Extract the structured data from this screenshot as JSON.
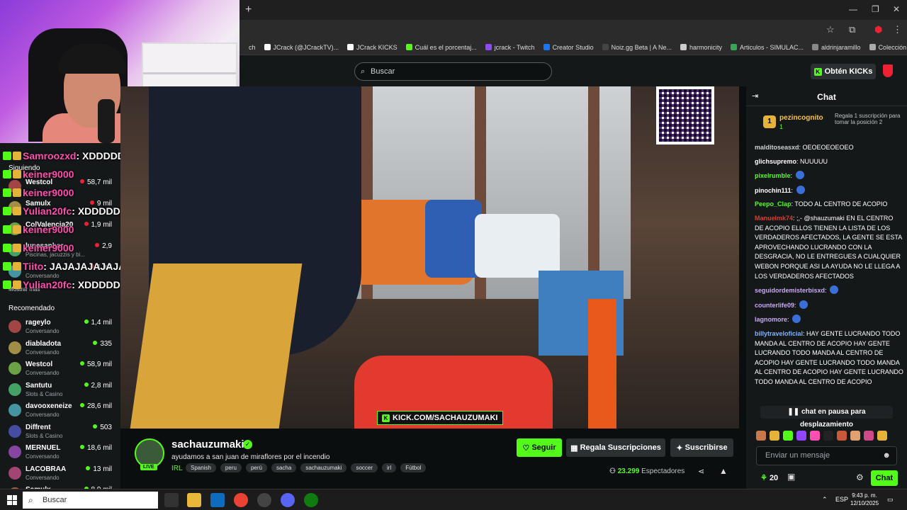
{
  "browser": {
    "new_tab": "+",
    "bookmarks": [
      {
        "label": "ch",
        "color": "#2b2b2b"
      },
      {
        "label": "JCrack (@JCrackTV)...",
        "color": "#ffffff"
      },
      {
        "label": "JCrack KICKS",
        "color": "#ffffff"
      },
      {
        "label": "Cuál es el porcentaj...",
        "color": "#53fc18"
      },
      {
        "label": "jcrack - Twitch",
        "color": "#9146ff"
      },
      {
        "label": "Creator Studio",
        "color": "#1877f2"
      },
      {
        "label": "Noiz.gg Beta | A Ne...",
        "color": "#444444"
      },
      {
        "label": "harmonicity",
        "color": "#cccccc"
      },
      {
        "label": "Articulos - SIMULAC...",
        "color": "#34a853"
      },
      {
        "label": "aldrinjaramillo",
        "color": "#888888"
      },
      {
        "label": "Colección de M_blei...",
        "color": "#aaaaaa"
      }
    ]
  },
  "topbar": {
    "search_placeholder": "Buscar",
    "get_kicks": "Obtén KICKs"
  },
  "overlay_chat": [
    {
      "user": "Samroozxd",
      "text": ": XDDDDDD"
    },
    {
      "user": "keiner9000",
      "text": ""
    },
    {
      "user": "keiner9000",
      "text": ""
    },
    {
      "user": "Yulian20fc",
      "text": ": XDDDDDDDDDD"
    },
    {
      "user": "keiner9000",
      "text": ""
    },
    {
      "user": "keiner9000",
      "text": ""
    },
    {
      "user": "Tiito",
      "text": ": JAJAJAJAJAJAJ"
    },
    {
      "user": "Yulian20fc",
      "text": ": XDDDDDD"
    }
  ],
  "sidebar": {
    "following_title": "Siguiendo",
    "following": [
      {
        "name": "Westcol",
        "category": "",
        "viewers": "58,7 mil"
      },
      {
        "name": "Samulx",
        "category": "",
        "viewers": "9 mil"
      },
      {
        "name": "ColValencia20",
        "category": "",
        "viewers": "1,9 mil"
      },
      {
        "name": "lunesanhar",
        "category": "Piscinas, jacuzzis y bi...",
        "viewers": "2,9"
      },
      {
        "name": "",
        "category": "Conversando",
        "viewers": "1 mil"
      }
    ],
    "show_more": "Mostrar más",
    "recommended_title": "Recomendado",
    "recommended": [
      {
        "name": "rageylo",
        "category": "Conversando",
        "viewers": "1,4 mil"
      },
      {
        "name": "diabladota",
        "category": "Conversando",
        "viewers": "335"
      },
      {
        "name": "Westcol",
        "category": "Conversando",
        "viewers": "58,9 mil"
      },
      {
        "name": "Santutu",
        "category": "Slots & Casino",
        "viewers": "2,8 mil"
      },
      {
        "name": "davooxeneize",
        "category": "Conversando",
        "viewers": "28,6 mil"
      },
      {
        "name": "Diffrent",
        "category": "Slots & Casino",
        "viewers": "503"
      },
      {
        "name": "MERNUEL",
        "category": "Conversando",
        "viewers": "18,6 mil"
      },
      {
        "name": "LACOBRAA",
        "category": "Conversando",
        "viewers": "13 mil"
      },
      {
        "name": "Samulx",
        "category": "",
        "viewers": "8,9 mil"
      }
    ]
  },
  "stream": {
    "watermark": "KICK.COM/SACHAUZUMAKI",
    "channel": "sachauzumaki",
    "live": "LIVE",
    "title": "ayudamos a san juan de miraflores por el incendio",
    "category": "IRL",
    "tags": [
      "Spanish",
      "peru",
      "perú",
      "sacha",
      "sachauzumaki",
      "soccer",
      "irl",
      "Fútbol"
    ],
    "follow": "Seguir",
    "gift": "Regala Suscripciones",
    "subscribe": "Suscribirse",
    "viewers": "23.299",
    "viewers_label": "Espectadores"
  },
  "chat": {
    "title": "Chat",
    "pinned": {
      "rank": "1",
      "user": "pezincognito",
      "count": "1",
      "message": "Regala 1 suscripción para tomar la posición 2"
    },
    "messages": [
      {
        "user": "malditoseasxd",
        "color": "#cfd3d5",
        "text": "OEOEOEOEOEO"
      },
      {
        "user": "glichsupremo",
        "color": "#ffffff",
        "text": "NUUUUU"
      },
      {
        "user": "pixelrumble",
        "color": "#53fc18",
        "text": ""
      },
      {
        "user": "pinochin111",
        "color": "#ffffff",
        "text": ""
      },
      {
        "user": "Peepo_Clap",
        "color": "#53fc18",
        "text": "TODO AL CENTRO DE ACOPIO"
      },
      {
        "user": "Manuelmk74",
        "color": "#e23a2f",
        "text": ";,- @shauzumaki EN EL CENTRO DE ACOPIO ELLOS TIENEN LA LISTA DE LOS VERDADEROS AFECTADOS, LA GENTE SE ESTA APROVECHANDO LUCRANDO CON LA DESGRACIA, NO LE ENTREGUES A CUALQUIER WEBON PORQUE ASI LA AYUDA NO LE LLEGA A LOS VERDADEROS AFECTADOS"
      },
      {
        "user": "seguidordemisterbisxd",
        "color": "#c9a9f5",
        "text": ""
      },
      {
        "user": "counterlife09",
        "color": "#c9a9f5",
        "text": ""
      },
      {
        "user": "lagnomore",
        "color": "#c9a9f5",
        "text": ""
      },
      {
        "user": "billytraveloficial",
        "color": "#7fb2ff",
        "text": "HAY GENTE LUCRANDO TODO MANDA AL CENTRO DE ACOPIO HAY GENTE LUCRANDO TODO MANDA AL CENTRO DE ACOPIO HAY GENTE LUCRANDO TODO MANDA AL CENTRO DE ACOPIO HAY GENTE LUCRANDO TODO MANDA AL CENTRO DE ACOPIO"
      }
    ],
    "paused": "chat en pausa para desplazamiento",
    "input_placeholder": "Enviar un mensaje",
    "points": "20",
    "send": "Chat"
  },
  "taskbar": {
    "search": "Buscar",
    "lang": "ESP",
    "time": "9:43 p. m.",
    "date": "12/10/2025"
  }
}
